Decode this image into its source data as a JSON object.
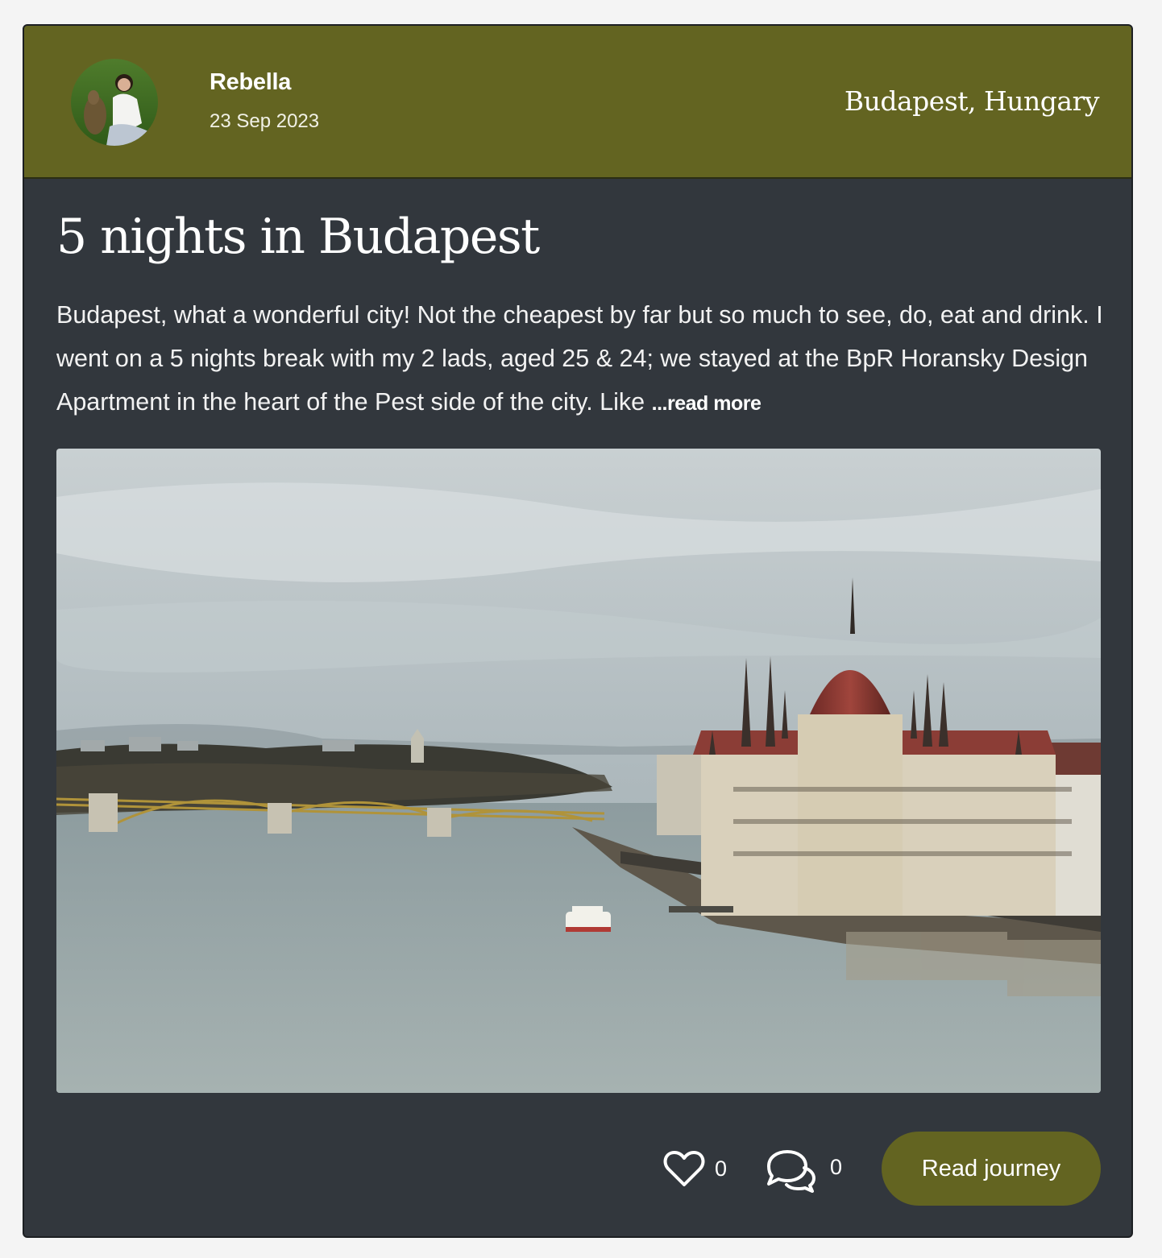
{
  "post": {
    "author": {
      "name": "Rebella",
      "date": "23 Sep 2023"
    },
    "location": "Budapest, Hungary",
    "title": "5 nights in Budapest",
    "excerpt": "Budapest, what a wonderful city! Not the cheapest by far but so much to see, do, eat and drink. I went on a 5 nights break with my 2 lads, aged 25 & 24; we stayed at the BpR Horansky Design Apartment in the heart of the Pest side of the city. Like",
    "read_more_label": "...read more"
  },
  "actions": {
    "likes": "0",
    "comments": "0",
    "read_button_label": "Read journey"
  },
  "icons": {
    "like": "heart-icon",
    "comment": "chat-bubbles-icon"
  },
  "colors": {
    "accent": "#636421",
    "card_background": "#32373d",
    "page_background": "#f4f4f4"
  }
}
